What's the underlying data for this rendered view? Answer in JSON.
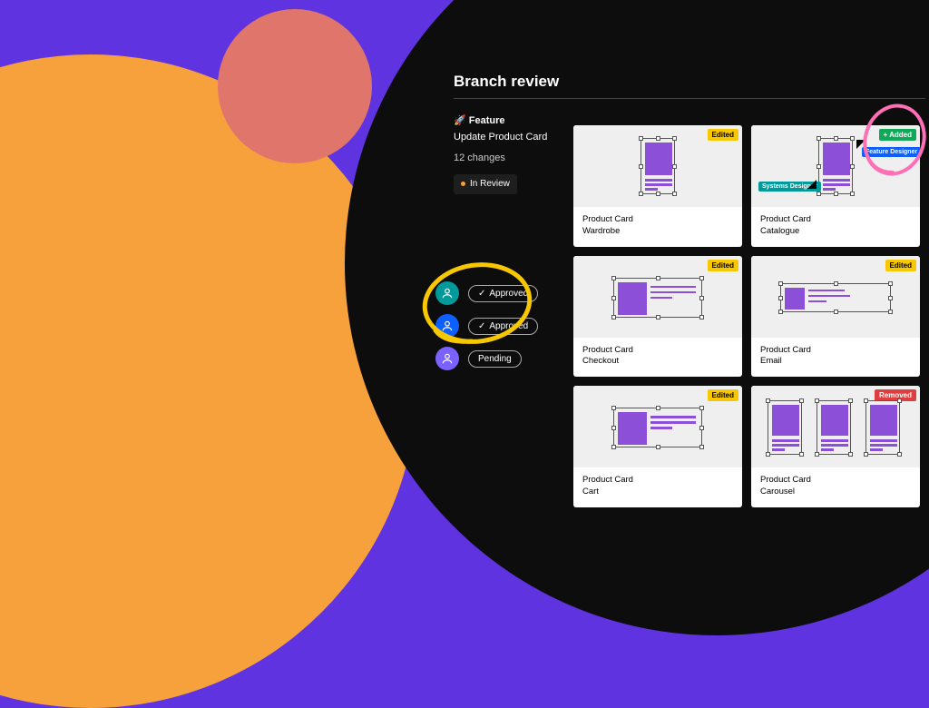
{
  "panel": {
    "title": "Branch review",
    "feature_icon": "🚀",
    "feature_label": "Feature",
    "feature_name": "Update Product Card",
    "changes": "12 changes",
    "review_status": "In Review"
  },
  "reviewers": [
    {
      "color": "teal",
      "status": "Approved",
      "icon": "check"
    },
    {
      "color": "blue",
      "status": "Approved",
      "icon": "check"
    },
    {
      "color": "violet",
      "status": "Pending",
      "icon": ""
    }
  ],
  "cards": [
    {
      "title": "Product Card",
      "subtitle": "Wardrobe",
      "badge": "Edited",
      "badge_type": "edited",
      "preview": "tall"
    },
    {
      "title": "Product Card",
      "subtitle": "Catalogue",
      "badge": "+ Added",
      "badge_type": "added",
      "preview": "tall",
      "cursors": true
    },
    {
      "title": "Product Card",
      "subtitle": "Checkout",
      "badge": "Edited",
      "badge_type": "edited",
      "preview": "wide"
    },
    {
      "title": "Product Card",
      "subtitle": "Email",
      "badge": "Edited",
      "badge_type": "edited",
      "preview": "wide"
    },
    {
      "title": "Product Card",
      "subtitle": "Cart",
      "badge": "Edited",
      "badge_type": "edited",
      "preview": "wide"
    },
    {
      "title": "Product Card",
      "subtitle": "Carousel",
      "badge": "Removed",
      "badge_type": "removed",
      "preview": "triple"
    }
  ],
  "cursor_labels": {
    "systems": "Systems Designer",
    "feature": "Feature Designer"
  }
}
